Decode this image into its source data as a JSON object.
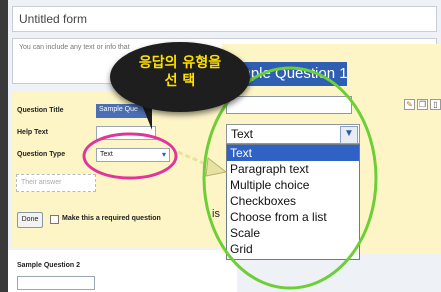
{
  "form": {
    "title": "Untitled form",
    "description": "You can include any text or info that"
  },
  "question_editor": {
    "title_label": "Question Title",
    "title_value": "Sample Que",
    "help_label": "Help Text",
    "type_label": "Question Type",
    "type_value": "Text",
    "answer_placeholder": "Their answer",
    "done_label": "Done",
    "required_label": "Make this a required question"
  },
  "next_question": {
    "label": "Sample Question 2"
  },
  "zoom": {
    "title_fragment": "ample Question 1",
    "select_value": "Text",
    "options": [
      "Text",
      "Paragraph text",
      "Multiple choice",
      "Checkboxes",
      "Choose from a list",
      "Scale",
      "Grid"
    ],
    "selected_index": 0,
    "partial_text": "is"
  },
  "callout": {
    "line1": "응답의 유형을",
    "line2": "선 택"
  },
  "colors": {
    "highlight_blue": "#2f5fb3",
    "panel_yellow": "#fdf5c6",
    "circle_pink": "#e0359a",
    "circle_green": "#6ccf35",
    "callout_text": "#ffe000"
  },
  "icons": [
    "chevron-down-icon",
    "edit-icon",
    "copy-icon",
    "trash-icon",
    "arrow-icon"
  ]
}
